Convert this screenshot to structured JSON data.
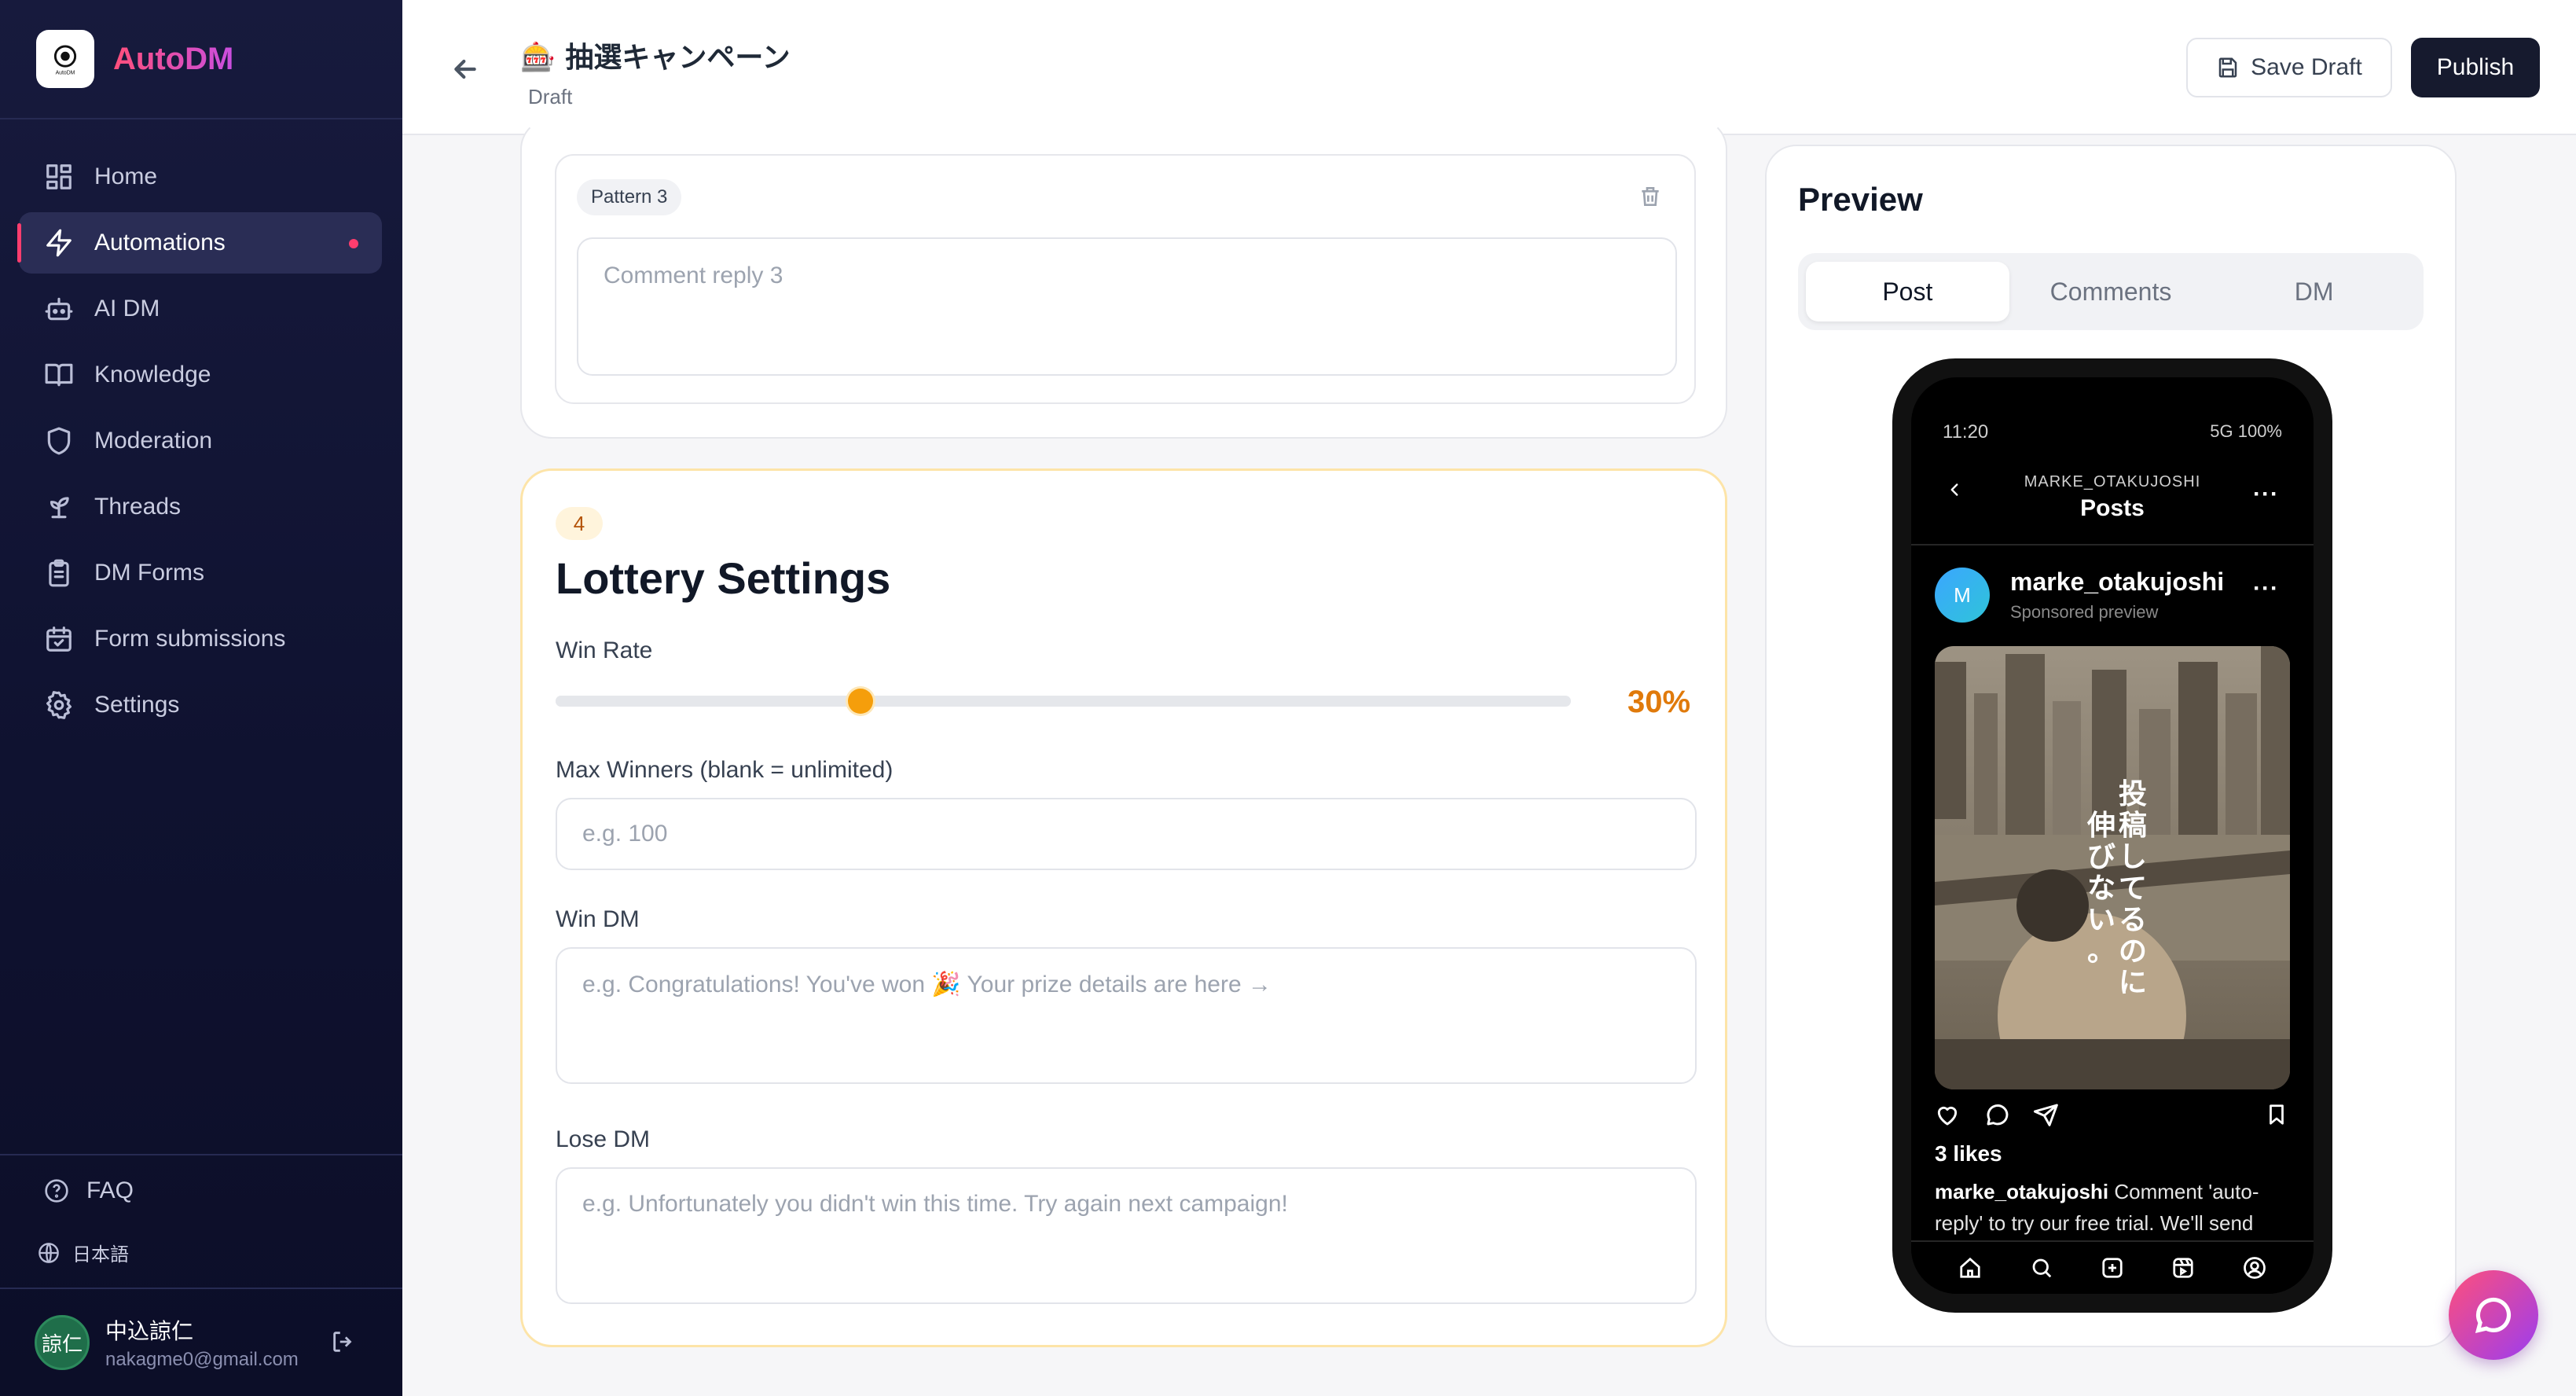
{
  "brand": {
    "name": "AutoDM",
    "logo_text": "AutoDM"
  },
  "sidebar": {
    "items": [
      {
        "label": "Home",
        "icon": "grid-icon"
      },
      {
        "label": "Automations",
        "icon": "bolt-icon",
        "active": true
      },
      {
        "label": "AI DM",
        "icon": "robot-icon"
      },
      {
        "label": "Knowledge",
        "icon": "book-icon"
      },
      {
        "label": "Moderation",
        "icon": "shield-icon"
      },
      {
        "label": "Threads",
        "icon": "sprout-icon"
      },
      {
        "label": "DM Forms",
        "icon": "clipboard-icon"
      },
      {
        "label": "Form submissions",
        "icon": "calendar-check-icon"
      },
      {
        "label": "Settings",
        "icon": "gear-icon"
      }
    ],
    "faq": "FAQ",
    "language": "日本語",
    "user": {
      "initials": "諒仁",
      "name": "中込諒仁",
      "email": "nakagme0@gmail.com"
    }
  },
  "header": {
    "emoji": "🎰",
    "title": "抽選キャンペーン",
    "status": "Draft",
    "save_draft": "Save Draft",
    "publish": "Publish"
  },
  "pattern": {
    "tag": "Pattern 3",
    "placeholder": "Comment reply 3"
  },
  "lottery": {
    "step": "4",
    "title": "Lottery Settings",
    "win_rate_label": "Win Rate",
    "win_rate_value": 30,
    "win_rate_display": "30%",
    "max_winners_label": "Max Winners (blank = unlimited)",
    "max_winners_placeholder": "e.g. 100",
    "win_dm_label": "Win DM",
    "win_dm_placeholder": "e.g. Congratulations! You've won 🎉 Your prize details are here →",
    "lose_dm_label": "Lose DM",
    "lose_dm_placeholder": "e.g. Unfortunately you didn't win this time. Try again next campaign!"
  },
  "preview": {
    "title": "Preview",
    "tabs": [
      "Post",
      "Comments",
      "DM"
    ],
    "active_tab": "Post",
    "phone": {
      "time": "11:20",
      "network": "5G 100%",
      "account_header": "MARKE_OTAKUJOSHI",
      "screen_title": "Posts",
      "avatar_letter": "M",
      "username": "marke_otakujoshi",
      "sponsored": "Sponsored preview",
      "image_text": "投稿してるのに伸びない。",
      "likes": "3 likes",
      "caption_user": "marke_otakujoshi",
      "caption_text": "Comment 'auto-reply' to try our free trial. We'll send"
    }
  },
  "colors": {
    "sidebar_bg": "#13163a",
    "accent": "#ff3d6e",
    "slider": "#f59e0b",
    "publish_bg": "#161a2e"
  }
}
